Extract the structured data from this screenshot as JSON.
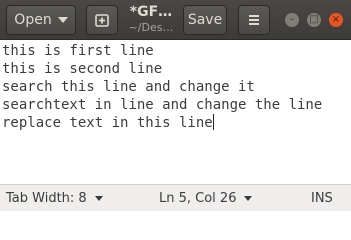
{
  "header": {
    "open_label": "Open",
    "title": "*GF…",
    "subtitle": "~/Des…",
    "save_label": "Save",
    "icons": {
      "open_dropdown": "chevron-down-icon",
      "new_tab": "new-document-icon",
      "menu": "hamburger-menu-icon",
      "minimize": "minimize-icon",
      "maximize": "maximize-icon",
      "close": "close-icon"
    }
  },
  "editor": {
    "lines": [
      "this is first line",
      "this is second line",
      "search this line and change it",
      "searchtext in line and change the line",
      "replace text in this line"
    ]
  },
  "status": {
    "tab_width": "Tab Width: 8",
    "position": "Ln 5, Col 26",
    "mode": "INS"
  },
  "colors": {
    "header_bg": "#3c3b37",
    "close_button": "#e95420",
    "editor_bg": "#ffffff",
    "status_bg": "#efeeec"
  }
}
